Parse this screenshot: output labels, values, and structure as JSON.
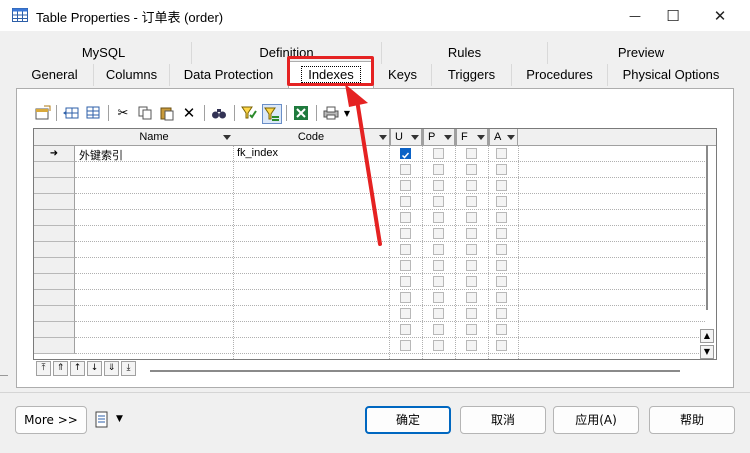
{
  "window": {
    "title": "Table Properties - 订单表 (order)",
    "minimize_glyph": "—",
    "maximize_glyph": "☐",
    "close_glyph": "✕"
  },
  "tabs": {
    "row1": [
      "MySQL",
      "Definition",
      "Rules",
      "Preview"
    ],
    "row2": [
      "General",
      "Columns",
      "Data Protection",
      "Indexes",
      "Keys",
      "Triggers",
      "Procedures",
      "Physical Options"
    ],
    "active": "Indexes"
  },
  "grid": {
    "columns": [
      "Name",
      "Code",
      "U",
      "P",
      "F",
      "A"
    ],
    "rows": [
      {
        "marker": "➜",
        "name": "外键索引",
        "code": "fk_index",
        "U": true,
        "P": false,
        "F": false,
        "A": false
      }
    ]
  },
  "footer": {
    "more": "More >>",
    "ok": "确定",
    "cancel": "取消",
    "apply": "应用(A)",
    "help": "帮助"
  },
  "colors": {
    "accent": "#0067c0",
    "annotation": "#e52222",
    "checked": "#0b62c6"
  }
}
